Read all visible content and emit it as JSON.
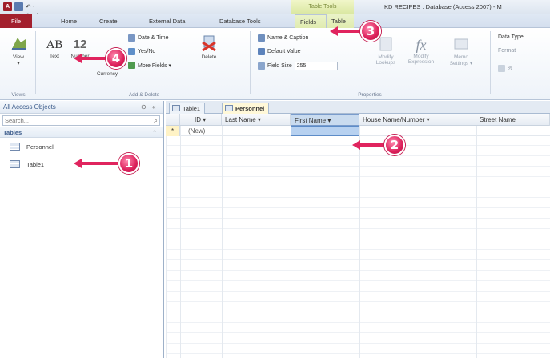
{
  "title_bar": {
    "access_icon": "A",
    "undo_redo": "↶ · ↷ · |▾",
    "contextual_group": "Table Tools",
    "window_title": "KD RECIPES : Database (Access 2007) - M"
  },
  "ribbon_tabs": [
    "File",
    "Home",
    "Create",
    "External Data",
    "Database Tools",
    "Fields",
    "Table"
  ],
  "ribbon": {
    "view_label": "View",
    "views_group": "Views",
    "text_icon": "AB",
    "text_label": "Text",
    "number_icon": "12",
    "number_label": "Number",
    "currency_label": "Currency",
    "date_time": "Date & Time",
    "yes_no": "Yes/No",
    "more_fields": "More Fields ▾",
    "delete_label": "Delete",
    "add_delete_group": "Add & Delete",
    "name_caption": "Name & Caption",
    "default_value": "Default Value",
    "field_size_label": "Field Size",
    "field_size_value": "255",
    "modify_lookups": "Modify Lookups",
    "expression_icon": "fx",
    "modify_expression": "Modify Expression",
    "memo_settings": "Memo Settings ▾",
    "properties_group": "Properties",
    "data_type": "Data Type",
    "format": "Format",
    "percent": "%"
  },
  "nav_pane": {
    "title": "All Access Objects",
    "search_placeholder": "Search...",
    "group": "Tables",
    "items": [
      "Personnel",
      "Table1"
    ]
  },
  "document": {
    "tabs": [
      "Table1",
      "Personnel"
    ],
    "columns": [
      "ID",
      "Last Name",
      "First Name",
      "House Name/Number",
      "Street Name"
    ],
    "new_row_marker": "*",
    "new_row_id": "(New)"
  },
  "callouts": [
    "1",
    "2",
    "3",
    "4"
  ],
  "colors": {
    "callout": "#e0245e",
    "file_tab": "#a3202d",
    "selection": "#b7d1f0"
  }
}
